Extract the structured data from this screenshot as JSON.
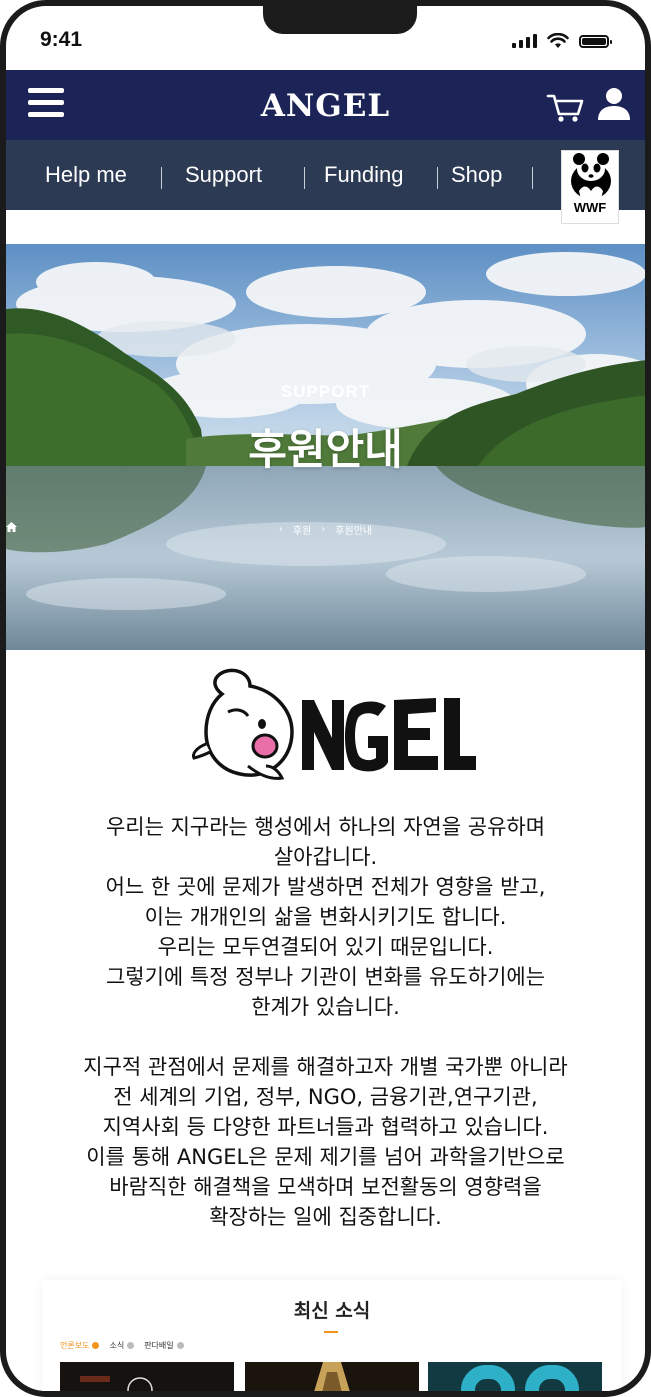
{
  "status_bar": {
    "time": "9:41"
  },
  "header": {
    "brand": "ANGEL"
  },
  "subnav": {
    "items": [
      "Help me",
      "Support",
      "Funding",
      "Shop"
    ],
    "partner_logo_text": "WWF"
  },
  "hero": {
    "eyebrow": "SUPPORT",
    "title": "후원안내",
    "breadcrumb": [
      "후원",
      "후원안내"
    ]
  },
  "logo": {
    "text": "ANGEL"
  },
  "intro": {
    "paragraph1": [
      "우리는 지구라는 행성에서 하나의 자연을 공유하며",
      "살아갑니다.",
      "어느 한 곳에 문제가 발생하면 전체가 영향을 받고,",
      "이는 개개인의 삶을 변화시키기도 합니다.",
      "우리는 모두연결되어 있기 때문입니다.",
      "그렇기에 특정 정부나 기관이 변화를 유도하기에는",
      "한계가 있습니다."
    ],
    "paragraph2": [
      "지구적 관점에서 문제를 해결하고자 개별 국가뿐 아니라",
      "전 세계의 기업, 정부, NGO, 금융기관,연구기관,",
      "지역사회 등 다양한 파트너들과 협력하고 있습니다.",
      "이를 통해 ANGEL은 문제 제기를 넘어 과학을기반으로",
      "바람직한 해결책을 모색하며 보전활동의 영향력을",
      "확장하는 일에 집중합니다."
    ]
  },
  "news": {
    "title": "최신 소식",
    "tabs": [
      {
        "label": "언론보도",
        "active": true
      },
      {
        "label": "소식",
        "active": false
      },
      {
        "label": "판다배일",
        "active": false
      }
    ]
  },
  "colors": {
    "navy": "#1c2357",
    "slate": "#2d3a54",
    "accent": "#f0941c"
  }
}
